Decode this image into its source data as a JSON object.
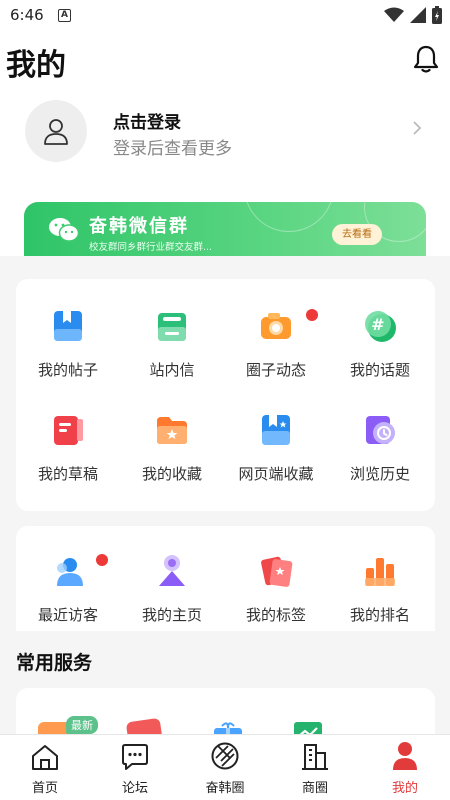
{
  "status_bar": {
    "time": "6:46",
    "a_icon": "A"
  },
  "header": {
    "title": "我的"
  },
  "login": {
    "title": "点击登录",
    "subtitle": "登录后查看更多"
  },
  "banner": {
    "title": "奋韩微信群",
    "subtitle": "校友群同乡群行业群交友群...",
    "button": "去看看"
  },
  "grid1": [
    {
      "label": "我的帖子",
      "icon": "post-icon"
    },
    {
      "label": "站内信",
      "icon": "inbox-icon",
      "dot": true
    },
    {
      "label": "圈子动态",
      "icon": "camera-icon"
    },
    {
      "label": "我的话题",
      "icon": "hashtag-icon"
    },
    {
      "label": "我的草稿",
      "icon": "draft-icon"
    },
    {
      "label": "我的收藏",
      "icon": "favorite-folder-icon"
    },
    {
      "label": "网页端收藏",
      "icon": "web-favorite-icon"
    },
    {
      "label": "浏览历史",
      "icon": "history-icon"
    }
  ],
  "grid2": [
    {
      "label": "最近访客",
      "icon": "visitor-icon",
      "dot": true
    },
    {
      "label": "我的主页",
      "icon": "homepage-icon"
    },
    {
      "label": "我的标签",
      "icon": "tag-icon"
    },
    {
      "label": "我的排名",
      "icon": "ranking-icon"
    }
  ],
  "services": {
    "title": "常用服务",
    "new_badge": "最新"
  },
  "tabbar": [
    {
      "label": "首页",
      "icon": "home-icon"
    },
    {
      "label": "论坛",
      "icon": "forum-icon"
    },
    {
      "label": "奋韩圈",
      "icon": "circle-icon"
    },
    {
      "label": "商圈",
      "icon": "business-icon"
    },
    {
      "label": "我的",
      "icon": "profile-icon",
      "active": true
    }
  ],
  "colors": {
    "accent": "#e23b3b",
    "banner_green": "#3fcb70",
    "dot_red": "#ee3939"
  }
}
